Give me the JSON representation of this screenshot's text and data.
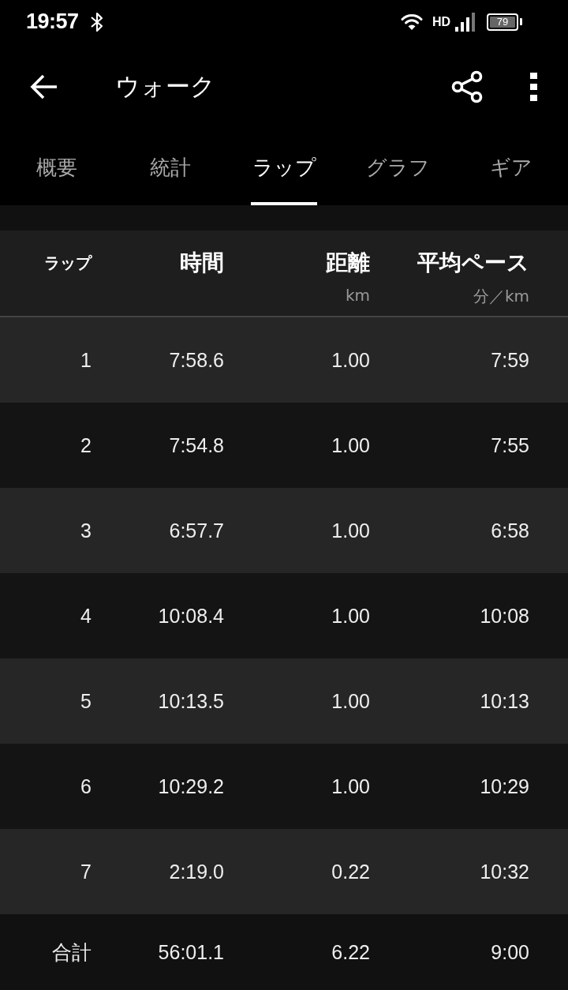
{
  "status_bar": {
    "time": "19:57",
    "network": "HD",
    "battery": "79"
  },
  "app_bar": {
    "title": "ウォーク"
  },
  "tabs": [
    {
      "label": "概要",
      "selected": false
    },
    {
      "label": "統計",
      "selected": false
    },
    {
      "label": "ラップ",
      "selected": true
    },
    {
      "label": "グラフ",
      "selected": false
    },
    {
      "label": "ギア",
      "selected": false
    }
  ],
  "table": {
    "columns": [
      {
        "label": "ラップ"
      },
      {
        "label": "時間"
      },
      {
        "label": "距離",
        "unit": "km"
      },
      {
        "label": "平均ペース",
        "unit": "分／km"
      }
    ],
    "rows": [
      {
        "cells": [
          "1",
          "7:58.6",
          "1.00",
          "7:59"
        ]
      },
      {
        "cells": [
          "2",
          "7:54.8",
          "1.00",
          "7:55"
        ]
      },
      {
        "cells": [
          "3",
          "6:57.7",
          "1.00",
          "6:58"
        ]
      },
      {
        "cells": [
          "4",
          "10:08.4",
          "1.00",
          "10:08"
        ]
      },
      {
        "cells": [
          "5",
          "10:13.5",
          "1.00",
          "10:13"
        ]
      },
      {
        "cells": [
          "6",
          "10:29.2",
          "1.00",
          "10:29"
        ]
      },
      {
        "cells": [
          "7",
          "2:19.0",
          "0.22",
          "10:32"
        ]
      }
    ],
    "total": {
      "cells": [
        "合計",
        "56:01.1",
        "6.22",
        "9:00"
      ]
    }
  }
}
